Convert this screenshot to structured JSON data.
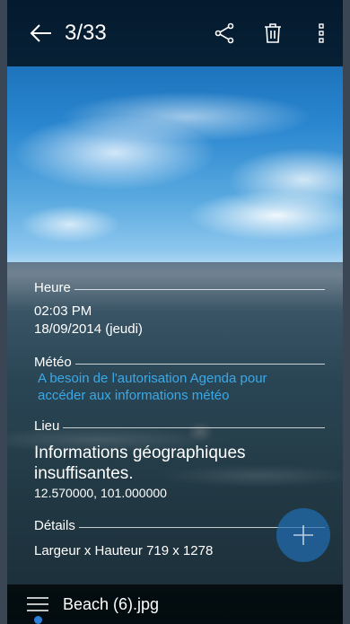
{
  "header": {
    "counter": "3/33",
    "icons": [
      "back-arrow-icon",
      "share-icon",
      "trash-icon",
      "more-vert-icon"
    ]
  },
  "info": {
    "time": {
      "label": "Heure",
      "time_value": "02:03 PM",
      "date_value": "18/09/2014 (jeudi)"
    },
    "weather": {
      "label": "Météo",
      "link": "A besoin de l'autorisation Agenda pour accéder aux informations météo"
    },
    "location": {
      "label": "Lieu",
      "message": "Informations géographiques insuffisantes.",
      "coords": "12.570000, 101.000000"
    },
    "details": {
      "label": "Détails",
      "row": "Largeur x Hauteur 719 x 1278"
    }
  },
  "footer": {
    "filename": "Beach (6).jpg"
  },
  "colors": {
    "link": "#3aa9e8",
    "accent": "#2b7fd4",
    "bars": "#000000"
  }
}
